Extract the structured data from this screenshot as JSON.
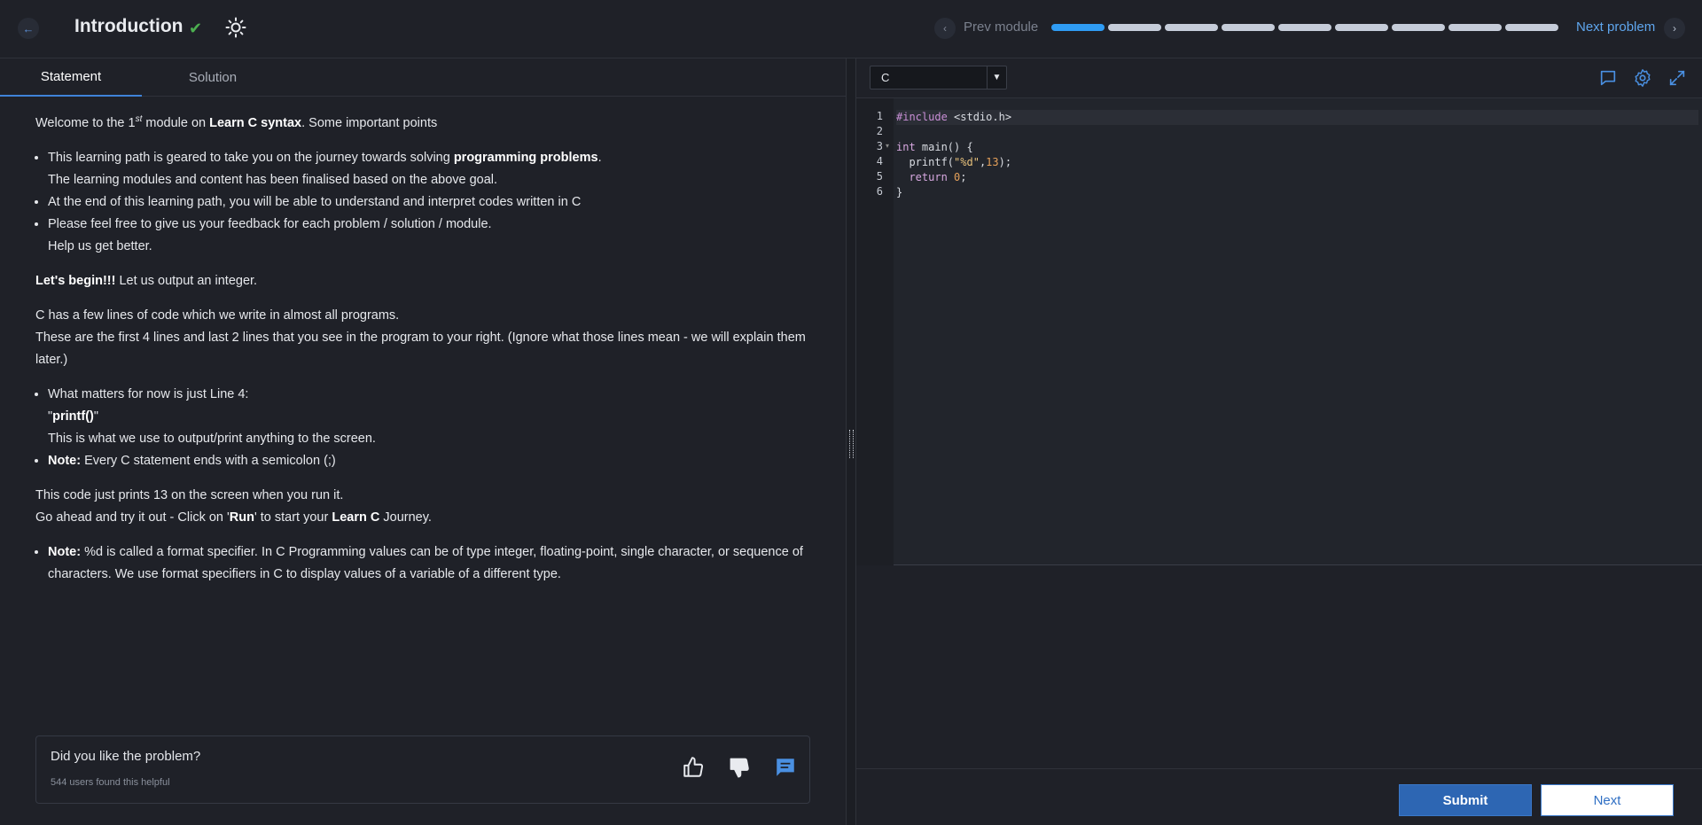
{
  "header": {
    "title": "Introduction",
    "prev_label": "Prev module",
    "next_label": "Next problem",
    "progress": {
      "total_segments": 9,
      "active_segment": 1
    }
  },
  "tabs": [
    {
      "label": "Statement",
      "active": true
    },
    {
      "label": "Solution",
      "active": false
    }
  ],
  "statement": {
    "intro_pre": "Welcome to the 1",
    "intro_sup": "st",
    "intro_mid": " module on ",
    "intro_bold": "Learn C syntax",
    "intro_post": ". Some important points",
    "b1_pre": "This learning path is geared to take you on the journey towards solving ",
    "b1_bold": "programming problems",
    "b1_post": ".",
    "b1_line2": "The learning modules and content has been finalised based on the above goal.",
    "b2": "At the end of this learning path, you will be able to understand and interpret codes written in C",
    "b3": "Please feel free to give us your feedback for each problem / solution / module.",
    "b3_line2": "Help us get better.",
    "begin_bold": "Let's begin!!!",
    "begin_rest": " Let us output an integer.",
    "para2_l1": "C has a few lines of code which we write in almost all programs.",
    "para2_l2": "These are the first 4 lines and last 2 lines that you see in the program to your right. (Ignore what those lines mean - we will explain them later.)",
    "b4_l1": "What matters for now is just Line 4:",
    "b4_quote_open": "\"",
    "b4_bold": "printf()",
    "b4_quote_close": "\"",
    "b4_l3": "This is what we use to output/print anything to the screen.",
    "b5_bold": "Note:",
    "b5_rest": " Every C statement ends with a semicolon (;)",
    "para3_l1": "This code just prints 13 on the screen when you run it.",
    "para3_l2_pre": "Go ahead and try it out - Click on '",
    "para3_l2_bold": "Run",
    "para3_l2_mid": "' to start your ",
    "para3_l2_bold2": "Learn C",
    "para3_l2_post": " Journey.",
    "b6_bold": "Note:",
    "b6_rest": " %d is called a format specifier. In C Programming values can be of type integer, floating-point, single character, or sequence of characters. We use format specifiers in C to display values of a variable of a different type."
  },
  "feedback": {
    "question": "Did you like the problem?",
    "count_text": "544 users found this helpful"
  },
  "editor": {
    "language": "C",
    "line_numbers": [
      "1",
      "2",
      "3",
      "4",
      "5",
      "6"
    ],
    "l1_kw": "#include",
    "l1_rest": " <stdio.h>",
    "l3_kw": "int",
    "l3_rest": " main() {",
    "l4_pre": "  printf(",
    "l4_str": "\"%d\"",
    "l4_comma": ",",
    "l4_num": "13",
    "l4_post": ");",
    "l5_kw": "  return",
    "l5_sp": " ",
    "l5_num": "0",
    "l5_post": ";",
    "l6": "}"
  },
  "actions": {
    "submit_label": "Submit",
    "next_label": "Next"
  },
  "colors": {
    "accent": "#2f9cf4",
    "submit": "#2d66b3",
    "check": "#4caf50"
  }
}
